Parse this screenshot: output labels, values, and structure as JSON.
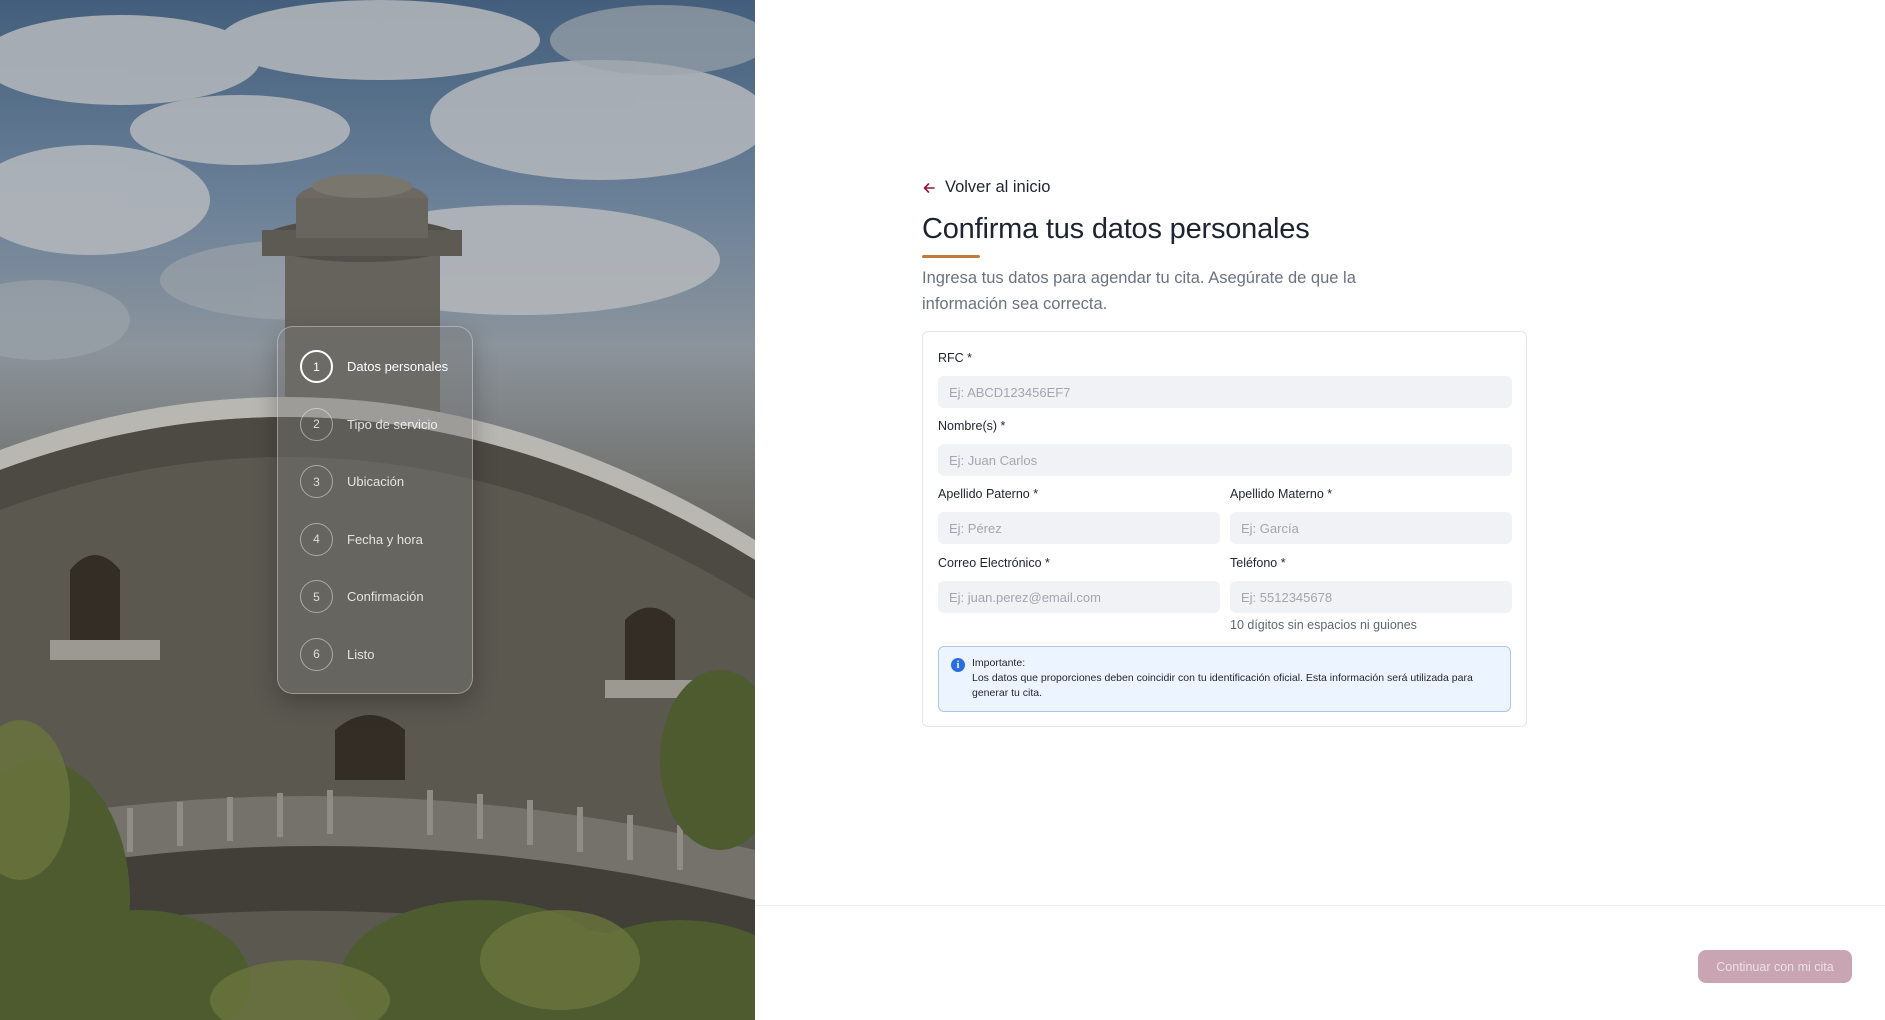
{
  "steps": [
    {
      "number": "1",
      "label": "Datos personales",
      "active": true
    },
    {
      "number": "2",
      "label": "Tipo de servicio"
    },
    {
      "number": "3",
      "label": "Ubicación"
    },
    {
      "number": "4",
      "label": "Fecha y hora"
    },
    {
      "number": "5",
      "label": "Confirmación"
    },
    {
      "number": "6",
      "label": "Listo"
    }
  ],
  "header": {
    "back_label": "Volver al inicio",
    "title": "Confirma tus datos personales",
    "subtitle": "Ingresa tus datos para agendar tu cita. Asegúrate de que la información sea correcta."
  },
  "form": {
    "rfc": {
      "label": "RFC *",
      "placeholder": "Ej: ABCD123456EF7",
      "value": ""
    },
    "nombre": {
      "label": "Nombre(s) *",
      "placeholder": "Ej: Juan Carlos",
      "value": ""
    },
    "apellido_paterno": {
      "label": "Apellido Paterno *",
      "placeholder": "Ej: Pérez",
      "value": ""
    },
    "apellido_materno": {
      "label": "Apellido Materno *",
      "placeholder": "Ej: García",
      "value": ""
    },
    "correo": {
      "label": "Correo Electrónico *",
      "placeholder": "Ej: juan.perez@email.com",
      "value": ""
    },
    "telefono": {
      "label": "Teléfono *",
      "placeholder": "Ej: 5512345678",
      "value": "",
      "hint": "10 dígitos sin espacios ni guiones"
    }
  },
  "notice": {
    "icon": "info-icon",
    "title": "Importante:",
    "body": "Los datos que proporciones deben coincidir con tu identificación oficial. Esta información será utilizada para generar tu cita."
  },
  "footer": {
    "continue_label": "Continuar con mi cita",
    "continue_enabled": false
  },
  "colors": {
    "accent_underline": "#c47a3a",
    "back_arrow": "#8a1c3a",
    "button_disabled": "#c9a4b3",
    "notice_bg": "#ecf4ff",
    "notice_border": "#a9c8ef"
  }
}
